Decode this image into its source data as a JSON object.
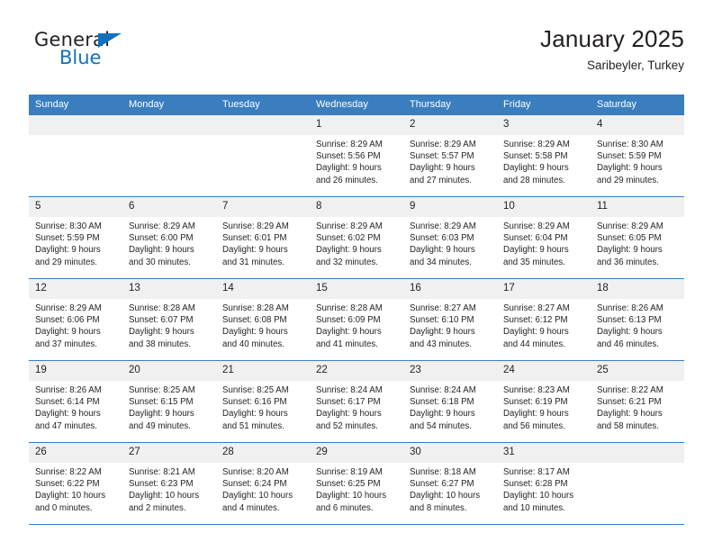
{
  "brand": {
    "name_top": "General",
    "name_bottom": "Blue",
    "triangle_color": "#1271bf"
  },
  "header": {
    "title": "January 2025",
    "subtitle": "Saribeyler, Turkey"
  },
  "calendar": {
    "accent_color": "#3a7ec0",
    "weekday_headers": [
      "Sunday",
      "Monday",
      "Tuesday",
      "Wednesday",
      "Thursday",
      "Friday",
      "Saturday"
    ],
    "labels": {
      "sunrise": "Sunrise:",
      "sunset": "Sunset:",
      "daylight": "Daylight:"
    },
    "weeks": [
      [
        {
          "day": "",
          "empty": true
        },
        {
          "day": "",
          "empty": true
        },
        {
          "day": "",
          "empty": true
        },
        {
          "day": "1",
          "sunrise": "Sunrise: 8:29 AM",
          "sunset": "Sunset: 5:56 PM",
          "daylight1": "Daylight: 9 hours",
          "daylight2": "and 26 minutes."
        },
        {
          "day": "2",
          "sunrise": "Sunrise: 8:29 AM",
          "sunset": "Sunset: 5:57 PM",
          "daylight1": "Daylight: 9 hours",
          "daylight2": "and 27 minutes."
        },
        {
          "day": "3",
          "sunrise": "Sunrise: 8:29 AM",
          "sunset": "Sunset: 5:58 PM",
          "daylight1": "Daylight: 9 hours",
          "daylight2": "and 28 minutes."
        },
        {
          "day": "4",
          "sunrise": "Sunrise: 8:30 AM",
          "sunset": "Sunset: 5:59 PM",
          "daylight1": "Daylight: 9 hours",
          "daylight2": "and 29 minutes."
        }
      ],
      [
        {
          "day": "5",
          "sunrise": "Sunrise: 8:30 AM",
          "sunset": "Sunset: 5:59 PM",
          "daylight1": "Daylight: 9 hours",
          "daylight2": "and 29 minutes."
        },
        {
          "day": "6",
          "sunrise": "Sunrise: 8:29 AM",
          "sunset": "Sunset: 6:00 PM",
          "daylight1": "Daylight: 9 hours",
          "daylight2": "and 30 minutes."
        },
        {
          "day": "7",
          "sunrise": "Sunrise: 8:29 AM",
          "sunset": "Sunset: 6:01 PM",
          "daylight1": "Daylight: 9 hours",
          "daylight2": "and 31 minutes."
        },
        {
          "day": "8",
          "sunrise": "Sunrise: 8:29 AM",
          "sunset": "Sunset: 6:02 PM",
          "daylight1": "Daylight: 9 hours",
          "daylight2": "and 32 minutes."
        },
        {
          "day": "9",
          "sunrise": "Sunrise: 8:29 AM",
          "sunset": "Sunset: 6:03 PM",
          "daylight1": "Daylight: 9 hours",
          "daylight2": "and 34 minutes."
        },
        {
          "day": "10",
          "sunrise": "Sunrise: 8:29 AM",
          "sunset": "Sunset: 6:04 PM",
          "daylight1": "Daylight: 9 hours",
          "daylight2": "and 35 minutes."
        },
        {
          "day": "11",
          "sunrise": "Sunrise: 8:29 AM",
          "sunset": "Sunset: 6:05 PM",
          "daylight1": "Daylight: 9 hours",
          "daylight2": "and 36 minutes."
        }
      ],
      [
        {
          "day": "12",
          "sunrise": "Sunrise: 8:29 AM",
          "sunset": "Sunset: 6:06 PM",
          "daylight1": "Daylight: 9 hours",
          "daylight2": "and 37 minutes."
        },
        {
          "day": "13",
          "sunrise": "Sunrise: 8:28 AM",
          "sunset": "Sunset: 6:07 PM",
          "daylight1": "Daylight: 9 hours",
          "daylight2": "and 38 minutes."
        },
        {
          "day": "14",
          "sunrise": "Sunrise: 8:28 AM",
          "sunset": "Sunset: 6:08 PM",
          "daylight1": "Daylight: 9 hours",
          "daylight2": "and 40 minutes."
        },
        {
          "day": "15",
          "sunrise": "Sunrise: 8:28 AM",
          "sunset": "Sunset: 6:09 PM",
          "daylight1": "Daylight: 9 hours",
          "daylight2": "and 41 minutes."
        },
        {
          "day": "16",
          "sunrise": "Sunrise: 8:27 AM",
          "sunset": "Sunset: 6:10 PM",
          "daylight1": "Daylight: 9 hours",
          "daylight2": "and 43 minutes."
        },
        {
          "day": "17",
          "sunrise": "Sunrise: 8:27 AM",
          "sunset": "Sunset: 6:12 PM",
          "daylight1": "Daylight: 9 hours",
          "daylight2": "and 44 minutes."
        },
        {
          "day": "18",
          "sunrise": "Sunrise: 8:26 AM",
          "sunset": "Sunset: 6:13 PM",
          "daylight1": "Daylight: 9 hours",
          "daylight2": "and 46 minutes."
        }
      ],
      [
        {
          "day": "19",
          "sunrise": "Sunrise: 8:26 AM",
          "sunset": "Sunset: 6:14 PM",
          "daylight1": "Daylight: 9 hours",
          "daylight2": "and 47 minutes."
        },
        {
          "day": "20",
          "sunrise": "Sunrise: 8:25 AM",
          "sunset": "Sunset: 6:15 PM",
          "daylight1": "Daylight: 9 hours",
          "daylight2": "and 49 minutes."
        },
        {
          "day": "21",
          "sunrise": "Sunrise: 8:25 AM",
          "sunset": "Sunset: 6:16 PM",
          "daylight1": "Daylight: 9 hours",
          "daylight2": "and 51 minutes."
        },
        {
          "day": "22",
          "sunrise": "Sunrise: 8:24 AM",
          "sunset": "Sunset: 6:17 PM",
          "daylight1": "Daylight: 9 hours",
          "daylight2": "and 52 minutes."
        },
        {
          "day": "23",
          "sunrise": "Sunrise: 8:24 AM",
          "sunset": "Sunset: 6:18 PM",
          "daylight1": "Daylight: 9 hours",
          "daylight2": "and 54 minutes."
        },
        {
          "day": "24",
          "sunrise": "Sunrise: 8:23 AM",
          "sunset": "Sunset: 6:19 PM",
          "daylight1": "Daylight: 9 hours",
          "daylight2": "and 56 minutes."
        },
        {
          "day": "25",
          "sunrise": "Sunrise: 8:22 AM",
          "sunset": "Sunset: 6:21 PM",
          "daylight1": "Daylight: 9 hours",
          "daylight2": "and 58 minutes."
        }
      ],
      [
        {
          "day": "26",
          "sunrise": "Sunrise: 8:22 AM",
          "sunset": "Sunset: 6:22 PM",
          "daylight1": "Daylight: 10 hours",
          "daylight2": "and 0 minutes."
        },
        {
          "day": "27",
          "sunrise": "Sunrise: 8:21 AM",
          "sunset": "Sunset: 6:23 PM",
          "daylight1": "Daylight: 10 hours",
          "daylight2": "and 2 minutes."
        },
        {
          "day": "28",
          "sunrise": "Sunrise: 8:20 AM",
          "sunset": "Sunset: 6:24 PM",
          "daylight1": "Daylight: 10 hours",
          "daylight2": "and 4 minutes."
        },
        {
          "day": "29",
          "sunrise": "Sunrise: 8:19 AM",
          "sunset": "Sunset: 6:25 PM",
          "daylight1": "Daylight: 10 hours",
          "daylight2": "and 6 minutes."
        },
        {
          "day": "30",
          "sunrise": "Sunrise: 8:18 AM",
          "sunset": "Sunset: 6:27 PM",
          "daylight1": "Daylight: 10 hours",
          "daylight2": "and 8 minutes."
        },
        {
          "day": "31",
          "sunrise": "Sunrise: 8:17 AM",
          "sunset": "Sunset: 6:28 PM",
          "daylight1": "Daylight: 10 hours",
          "daylight2": "and 10 minutes."
        },
        {
          "day": "",
          "empty": true
        }
      ]
    ]
  }
}
